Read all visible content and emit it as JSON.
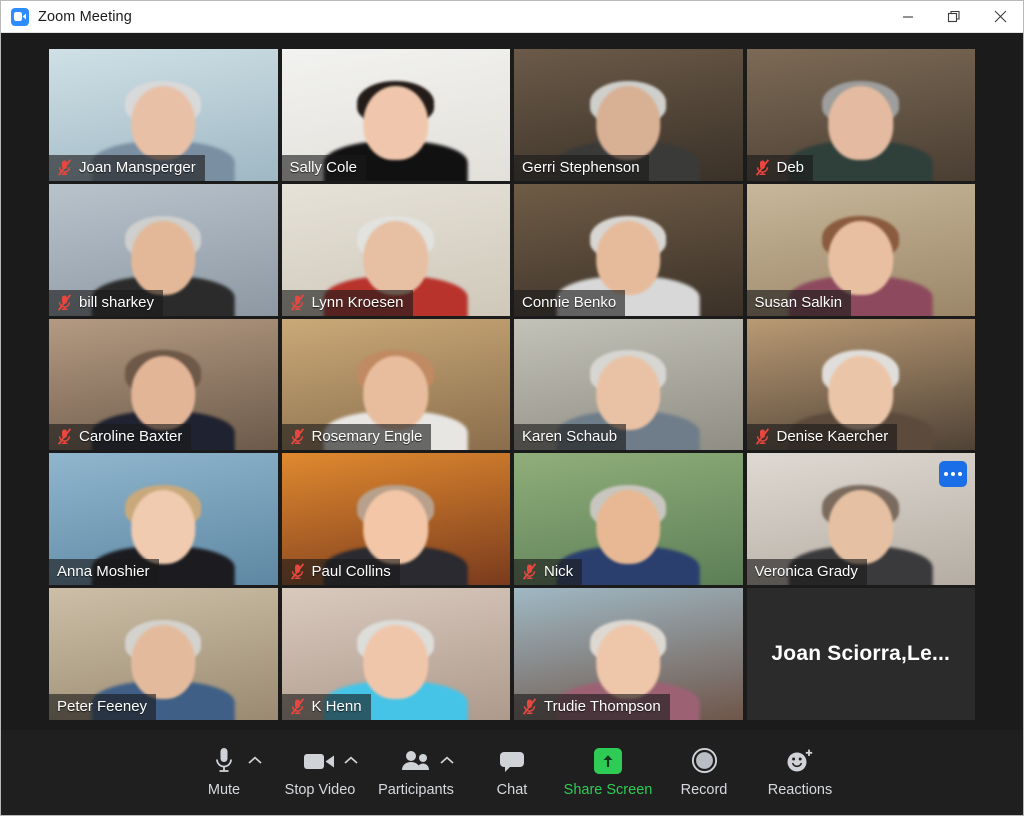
{
  "window": {
    "title": "Zoom Meeting",
    "app_icon": "zoom-video-icon",
    "controls": {
      "minimize": "minimize-icon",
      "restore": "restore-icon",
      "close": "close-icon"
    }
  },
  "colors": {
    "active_speaker_border": "#c0e741",
    "accent_green": "#2ecc55",
    "more_button_blue": "#1a6fe8",
    "muted_mic_red": "#e8473f",
    "window_background": "#1b1b1b",
    "toolbar_background": "#1f1f1f"
  },
  "grid": {
    "columns": 4,
    "rows": 5,
    "participants": [
      {
        "name": "Joan Mansperger",
        "muted": true,
        "active_speaker": false,
        "video_on": true,
        "more_menu": false,
        "skin": "#e8c0a6",
        "hair": "#d9d9d9",
        "clothes": "#7b8fa3",
        "bg_top": "#cfe0e6",
        "bg_bottom": "#9fb8c4"
      },
      {
        "name": "Sally Cole",
        "muted": false,
        "active_speaker": true,
        "video_on": true,
        "more_menu": false,
        "skin": "#f0c7ac",
        "hair": "#241c18",
        "clothes": "#111111",
        "bg_top": "#f2f2f0",
        "bg_bottom": "#e3e0da"
      },
      {
        "name": "Gerri Stephenson",
        "muted": false,
        "active_speaker": false,
        "video_on": true,
        "more_menu": false,
        "skin": "#d8b094",
        "hair": "#cfcfcb",
        "clothes": "#3a3a38",
        "bg_top": "#6b5a48",
        "bg_bottom": "#3a3128"
      },
      {
        "name": "Deb",
        "muted": true,
        "active_speaker": false,
        "video_on": true,
        "more_menu": false,
        "skin": "#e4bba0",
        "hair": "#9e9e9c",
        "clothes": "#2f3f3a",
        "bg_top": "#7c6a55",
        "bg_bottom": "#4a3e33"
      },
      {
        "name": "bill sharkey",
        "muted": true,
        "active_speaker": false,
        "video_on": true,
        "more_menu": false,
        "skin": "#e3b898",
        "hair": "#cfcfcd",
        "clothes": "#2b2b2b",
        "bg_top": "#b8c3cc",
        "bg_bottom": "#8d98a3"
      },
      {
        "name": "Lynn Kroesen",
        "muted": true,
        "active_speaker": false,
        "video_on": true,
        "more_menu": false,
        "skin": "#e7bfa3",
        "hair": "#e2e2df",
        "clothes": "#b8332c",
        "bg_top": "#e6e2d8",
        "bg_bottom": "#cfc8ba"
      },
      {
        "name": "Connie Benko",
        "muted": false,
        "active_speaker": false,
        "video_on": true,
        "more_menu": false,
        "skin": "#e5bb9c",
        "hair": "#d8d6d2",
        "clothes": "#d8d8d8",
        "bg_top": "#6f5c46",
        "bg_bottom": "#3b3128"
      },
      {
        "name": "Susan Salkin",
        "muted": false,
        "active_speaker": false,
        "video_on": true,
        "more_menu": false,
        "skin": "#e9bfa2",
        "hair": "#8a5b3f",
        "clothes": "#8d4a5e",
        "bg_top": "#c8b79a",
        "bg_bottom": "#9b8668"
      },
      {
        "name": "Caroline Baxter",
        "muted": true,
        "active_speaker": false,
        "video_on": true,
        "more_menu": false,
        "skin": "#e3b597",
        "hair": "#6e5848",
        "clothes": "#1f2230",
        "bg_top": "#b49a82",
        "bg_bottom": "#6c5a4a"
      },
      {
        "name": "Rosemary Engle",
        "muted": true,
        "active_speaker": false,
        "video_on": true,
        "more_menu": false,
        "skin": "#e8bd9e",
        "hair": "#c08a62",
        "clothes": "#e8e6e3",
        "bg_top": "#caa978",
        "bg_bottom": "#8a6e4c"
      },
      {
        "name": "Karen Schaub",
        "muted": false,
        "active_speaker": false,
        "video_on": true,
        "more_menu": false,
        "skin": "#e9c2a5",
        "hair": "#d7d6d2",
        "clothes": "#6f7d8a",
        "bg_top": "#c3c2b8",
        "bg_bottom": "#8f8d84"
      },
      {
        "name": "Denise Kaercher",
        "muted": true,
        "active_speaker": false,
        "video_on": true,
        "more_menu": false,
        "skin": "#ebc5a8",
        "hair": "#e0dedb",
        "clothes": "#5c4a3c",
        "bg_top": "#b99a74",
        "bg_bottom": "#73594180"
      },
      {
        "name": "Anna Moshier",
        "muted": false,
        "active_speaker": false,
        "video_on": true,
        "more_menu": false,
        "skin": "#f0cbb0",
        "hair": "#c9a97c",
        "clothes": "#1c1c20",
        "bg_top": "#8fb6cd",
        "bg_bottom": "#5e87a3"
      },
      {
        "name": "Paul Collins",
        "muted": true,
        "active_speaker": false,
        "video_on": true,
        "more_menu": false,
        "skin": "#f2c6a6",
        "hair": "#b8a18c",
        "clothes": "#2a2a30",
        "bg_top": "#e0892f",
        "bg_bottom": "#7a3b1d"
      },
      {
        "name": "Nick",
        "muted": true,
        "active_speaker": false,
        "video_on": true,
        "more_menu": false,
        "skin": "#e7b893",
        "hair": "#c9c6bf",
        "clothes": "#2a3f6e",
        "bg_top": "#8fae7a",
        "bg_bottom": "#5d7f57"
      },
      {
        "name": "Veronica Grady",
        "muted": false,
        "active_speaker": false,
        "video_on": true,
        "more_menu": true,
        "skin": "#e6c0a2",
        "hair": "#7a6b5e",
        "clothes": "#3a3a3c",
        "bg_top": "#ded9d2",
        "bg_bottom": "#b5ada3"
      },
      {
        "name": "Peter Feeney",
        "muted": false,
        "active_speaker": false,
        "video_on": true,
        "more_menu": false,
        "skin": "#e3bb9c",
        "hair": "#d4d2cd",
        "clothes": "#3f5f86",
        "bg_top": "#cdbfa7",
        "bg_bottom": "#9a8a72"
      },
      {
        "name": "K Henn",
        "muted": true,
        "active_speaker": false,
        "video_on": true,
        "more_menu": false,
        "skin": "#f0c6aa",
        "hair": "#ddddda",
        "clothes": "#45c4e8",
        "bg_top": "#d9c9bd",
        "bg_bottom": "#ad9a8c"
      },
      {
        "name": "Trudie Thompson",
        "muted": true,
        "active_speaker": false,
        "video_on": true,
        "more_menu": false,
        "skin": "#eec6a9",
        "hair": "#ddd9d2",
        "clothes": "#9c6274",
        "bg_top": "#9fb8c4",
        "bg_bottom": "#6f564a"
      },
      {
        "name": "Joan  Sciorra,Le...",
        "muted": false,
        "active_speaker": false,
        "video_on": false,
        "more_menu": false,
        "skin": "",
        "hair": "",
        "clothes": "",
        "bg_top": "#2b2b2b",
        "bg_bottom": "#2b2b2b"
      }
    ]
  },
  "toolbar": {
    "items": [
      {
        "label": "Mute",
        "icon": "microphone-icon",
        "caret": true,
        "accent": false
      },
      {
        "label": "Stop Video",
        "icon": "video-camera-icon",
        "caret": true,
        "accent": false
      },
      {
        "label": "Participants",
        "icon": "participants-icon",
        "caret": true,
        "accent": false
      },
      {
        "label": "Chat",
        "icon": "chat-bubble-icon",
        "caret": false,
        "accent": false
      },
      {
        "label": "Share Screen",
        "icon": "share-screen-icon",
        "caret": false,
        "accent": true
      },
      {
        "label": "Record",
        "icon": "record-icon",
        "caret": false,
        "accent": false
      },
      {
        "label": "Reactions",
        "icon": "reactions-icon",
        "caret": false,
        "accent": false
      }
    ]
  }
}
